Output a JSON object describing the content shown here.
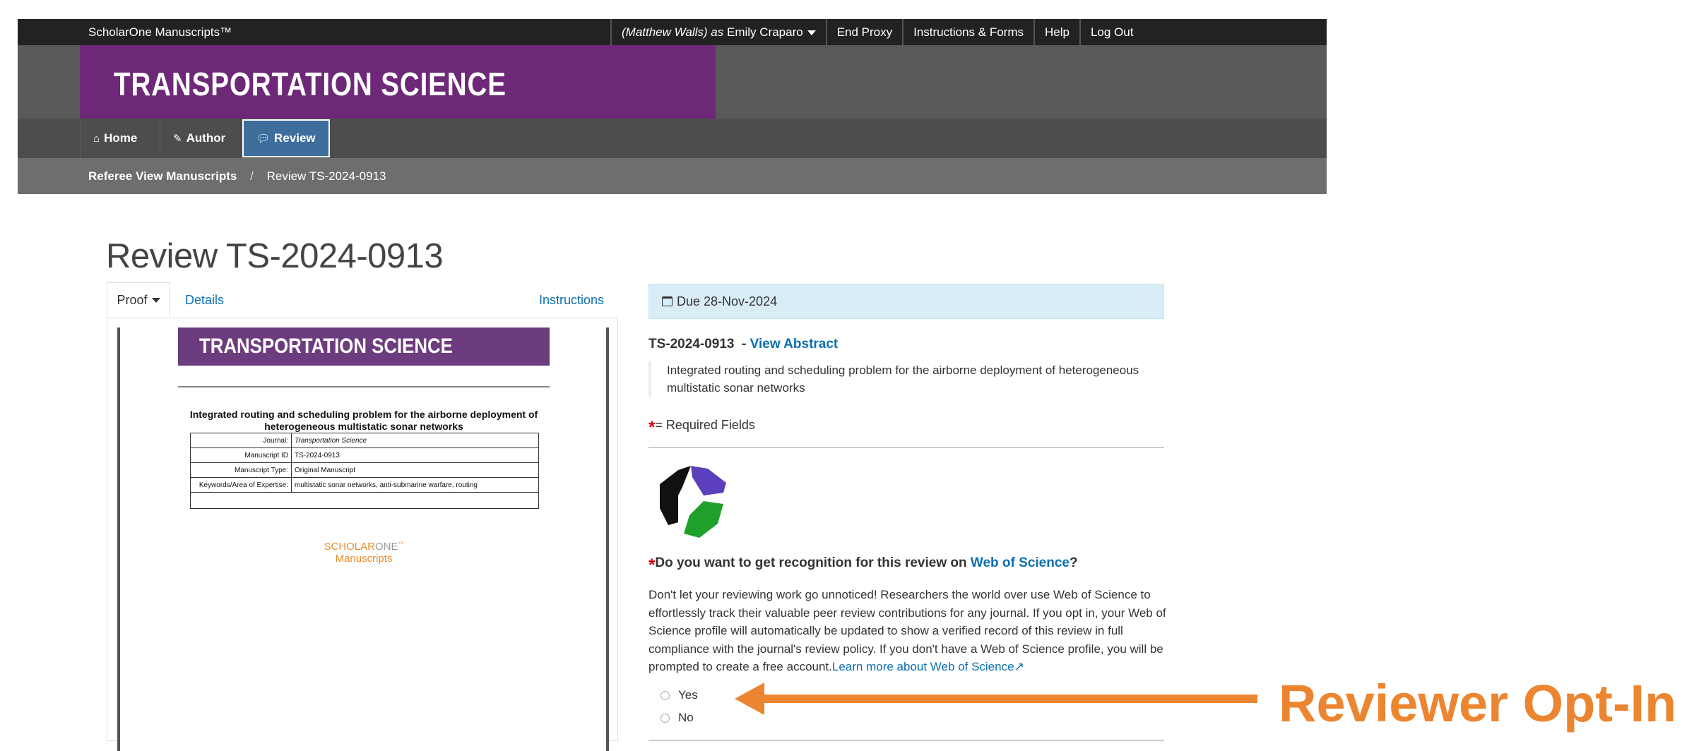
{
  "topbar": {
    "brand": "ScholarOne Manuscripts™",
    "proxy_user": "(Matthew Walls)",
    "proxy_as": "as",
    "user_name": "Emily Craparo",
    "end_proxy": "End Proxy",
    "instructions_forms": "Instructions & Forms",
    "help": "Help",
    "logout": "Log Out"
  },
  "banner": {
    "journal_title": "TRANSPORTATION SCIENCE"
  },
  "nav": {
    "home": "Home",
    "author": "Author",
    "review": "Review"
  },
  "breadcrumb": {
    "parent": "Referee View Manuscripts",
    "separator": "/",
    "current": "Review TS-2024-0913"
  },
  "page_title": "Review TS-2024-0913",
  "left_tabs": {
    "proof": "Proof",
    "details": "Details",
    "instructions": "Instructions"
  },
  "proof": {
    "header": "TRANSPORTATION SCIENCE",
    "title": "Integrated routing and scheduling problem for the airborne deployment of heterogeneous multistatic sonar networks",
    "rows": [
      {
        "key": "Journal:",
        "value": "Transportation Science"
      },
      {
        "key": "Manuscript ID",
        "value": "TS-2024-0913"
      },
      {
        "key": "Manuscript Type:",
        "value": "Original Manuscript"
      },
      {
        "key": "Keywords/Area of Expertise:",
        "value": "multistatic sonar networks, anti-submarine warfare, routing"
      }
    ],
    "logo_line1_a": "SCHOLAR",
    "logo_line1_b": "ONE",
    "logo_tm": "™",
    "logo_line2": "Manuscripts"
  },
  "right": {
    "due": "Due 28-Nov-2024",
    "manuscript_id": "TS-2024-0913",
    "dash": "-",
    "view_abstract": "View Abstract",
    "abstract_title": "Integrated routing and scheduling problem for the airborne deployment of heterogeneous multistatic sonar networks",
    "required_star": "*",
    "required_text": "= Required Fields",
    "question_pre": "Do you want to get recognition for this review on",
    "question_link": "Web of Science",
    "question_post": "?",
    "paragraph": "Don't let your reviewing work go unnoticed! Researchers the world over use Web of Science to effortlessly track their valuable peer review contributions for any journal. If you opt in, your Web of Science profile will automatically be updated to show a verified record of this review in full compliance with the journal's review policy. If you don't have a Web of Science profile, you will be prompted to create a free account.",
    "learn_more": "Learn more about Web of Science",
    "option_yes": "Yes",
    "option_no": "No"
  },
  "annotation": {
    "label": "Reviewer Opt-In",
    "color": "#ec8530"
  },
  "colors": {
    "brand_purple": "#6d2877",
    "active_tab": "#3d6e9c",
    "link": "#0b6fb2",
    "due_bg": "#d9edf7"
  },
  "icons": [
    "home-icon",
    "pencil-icon",
    "comment-icon",
    "caret-down-icon",
    "calendar-icon",
    "external-link-icon",
    "web-of-science-logo"
  ]
}
